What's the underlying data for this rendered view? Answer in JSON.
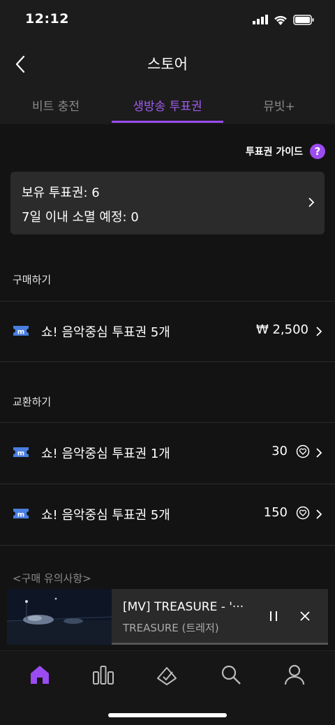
{
  "status": {
    "time": "12:12"
  },
  "nav": {
    "title": "스토어"
  },
  "tabs": [
    {
      "label": "비트 충전"
    },
    {
      "label": "생방송 투표권"
    },
    {
      "label": "뮤빗+"
    }
  ],
  "guide": {
    "label": "투표권 가이드",
    "icon": "?"
  },
  "summary": {
    "held": "보유 투표권: 6",
    "expiring": "7일 이내 소멸 예정: 0"
  },
  "purchase": {
    "header": "구매하기",
    "items": [
      {
        "name": "쇼! 음악중심 투표권 5개",
        "price": "₩ 2,500"
      }
    ]
  },
  "exchange": {
    "header": "교환하기",
    "items": [
      {
        "name": "쇼! 음악중심 투표권 1개",
        "amount": "30"
      },
      {
        "name": "쇼! 음악중심 투표권 5개",
        "amount": "150"
      }
    ]
  },
  "notice": {
    "header": "<구매 유의사항>"
  },
  "player": {
    "title": "[MV] TREASURE - '···",
    "artist": "TREASURE (트레저)",
    "progress": 0.0
  },
  "colors": {
    "accent": "#9b4cf0",
    "ticket": "#4a7ee0"
  }
}
